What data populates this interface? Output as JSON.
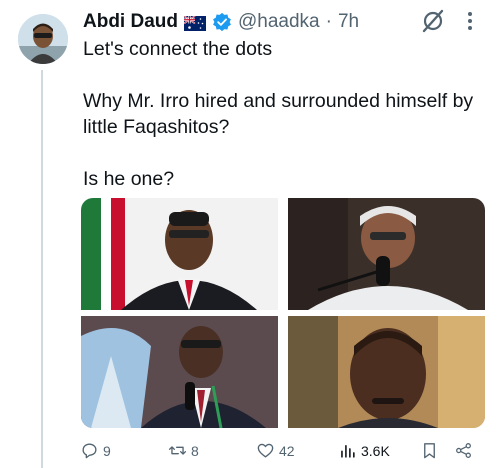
{
  "tweet": {
    "author": {
      "display_name": "Abdi Daud",
      "handle": "@haadka",
      "flag_icon": "australia-flag-icon",
      "verified_icon": "verified-badge-icon",
      "verified_color": "#1d9bf0"
    },
    "separator": "·",
    "timestamp": "7h",
    "text_lines": [
      "Let's connect the dots",
      "",
      "Why Mr. Irro hired and surrounded himself by",
      "little Faqashitos?",
      "",
      "Is he one?"
    ],
    "media": [
      {
        "kind": "photo",
        "icon": "photo"
      },
      {
        "kind": "photo",
        "icon": "photo"
      },
      {
        "kind": "photo",
        "icon": "photo"
      },
      {
        "kind": "photo",
        "icon": "photo"
      }
    ],
    "actions": {
      "replies": "9",
      "reposts": "8",
      "likes": "42",
      "views": "3.6K"
    },
    "colors": {
      "text": "#0f1419",
      "muted": "#536471",
      "accent": "#1d9bf0"
    }
  }
}
